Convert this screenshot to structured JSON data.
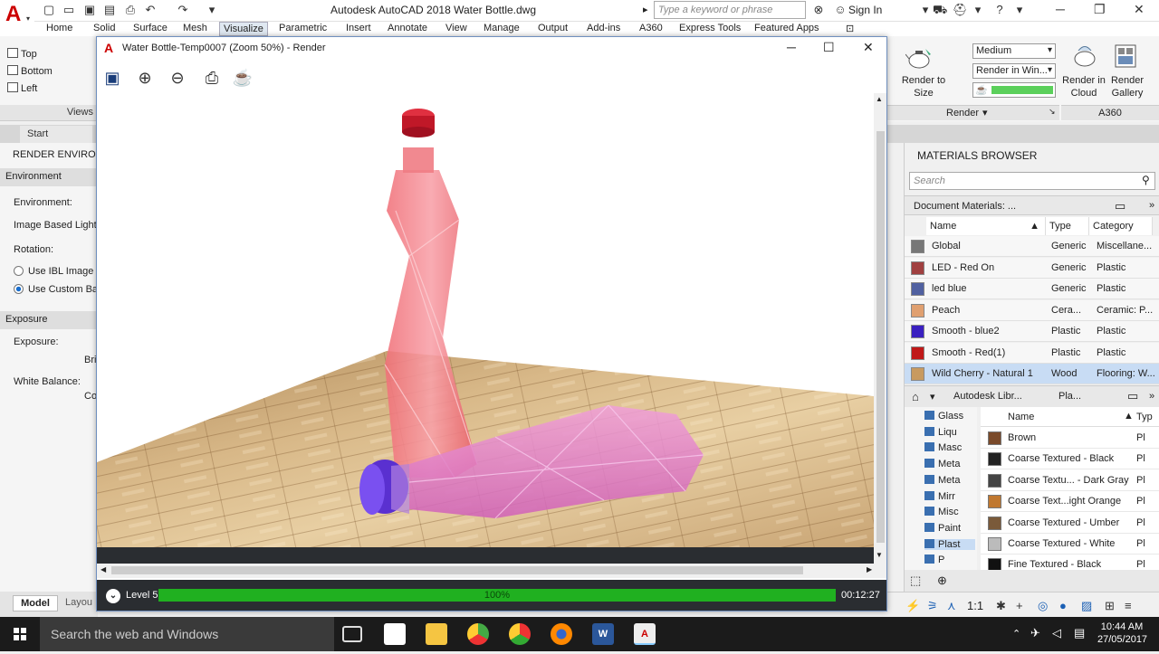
{
  "app": {
    "title": "Autodesk AutoCAD 2018   Water Bottle.dwg",
    "search_placeholder": "Type a keyword or phrase",
    "sign_in": "Sign In"
  },
  "ribbon_tabs": [
    "Home",
    "Solid",
    "Surface",
    "Mesh",
    "Visualize",
    "Parametric",
    "Insert",
    "Annotate",
    "View",
    "Manage",
    "Output",
    "Add-ins",
    "A360",
    "Express Tools",
    "Featured Apps"
  ],
  "views_panel": {
    "items": [
      "Top",
      "Bottom",
      "Left"
    ],
    "label": "Views"
  },
  "start_tab": "Start",
  "render_env": {
    "title": "RENDER ENVIRONI",
    "environment_section": "Environment",
    "environment_label": "Environment:",
    "ibl_label": "Image Based Light",
    "rotation_label": "Rotation:",
    "use_ibl": "Use IBL Image",
    "use_custom": "Use Custom Ba",
    "exposure_section": "Exposure",
    "exposure_label": "Exposure:",
    "bri": "Bri",
    "white_balance": "White Balance:",
    "co": "Co"
  },
  "layout_tabs": {
    "model": "Model",
    "layout": "Layou"
  },
  "render_window": {
    "title": "Water Bottle-Temp0007 (Zoom 50%) - Render",
    "level": "Level 5",
    "progress_label": "100%",
    "progress": 1.0,
    "time": "00:12:27"
  },
  "render_panel": {
    "quality": "Medium",
    "render_in": "Render in Win...",
    "render_to_size": "Render to Size",
    "render_in_cloud": "Render in Cloud",
    "render_gallery": "Render Gallery",
    "render_label": "Render",
    "a360_label": "A360"
  },
  "materials_browser": {
    "title": "MATERIALS BROWSER",
    "search_placeholder": "Search",
    "doc_materials": "Document Materials: ...",
    "columns": {
      "name": "Name",
      "type": "Type",
      "category": "Category"
    },
    "rows": [
      {
        "name": "Global",
        "type": "Generic",
        "category": "Miscellane...",
        "color": "#777777"
      },
      {
        "name": "LED - Red On",
        "type": "Generic",
        "category": "Plastic",
        "color": "#a04040"
      },
      {
        "name": "led blue",
        "type": "Generic",
        "category": "Plastic",
        "color": "#5060a0"
      },
      {
        "name": "Peach",
        "type": "Cera...",
        "category": "Ceramic: P...",
        "color": "#e0a070"
      },
      {
        "name": "Smooth - blue2",
        "type": "Plastic",
        "category": "Plastic",
        "color": "#3a20c0"
      },
      {
        "name": "Smooth - Red(1)",
        "type": "Plastic",
        "category": "Plastic",
        "color": "#c01818"
      },
      {
        "name": "Wild Cherry - Natural 1",
        "type": "Wood",
        "category": "Flooring: W...",
        "color": "#c89a60"
      }
    ],
    "library_path": [
      "Autodesk Libr...",
      "Pla..."
    ],
    "tree": [
      "Glass",
      "Liqu",
      "Masc",
      "Meta",
      "Meta",
      "Mirr",
      "Misc",
      "Paint",
      "Plast",
      "P"
    ],
    "library_columns": {
      "name": "Name",
      "type": "Typ"
    },
    "library_rows": [
      {
        "name": "Brown",
        "type": "Pl",
        "color": "#7a4a2a"
      },
      {
        "name": "Coarse Textured - Black",
        "type": "Pl",
        "color": "#222222"
      },
      {
        "name": "Coarse Textu... - Dark Gray",
        "type": "Pl",
        "color": "#444444"
      },
      {
        "name": "Coarse Text...ight Orange",
        "type": "Pl",
        "color": "#c07830"
      },
      {
        "name": "Coarse Textured - Umber",
        "type": "Pl",
        "color": "#7a5a3a"
      },
      {
        "name": "Coarse Textured - White",
        "type": "Pl",
        "color": "#bbbbbb"
      },
      {
        "name": "Fine Textured - Black",
        "type": "Pl",
        "color": "#111111"
      }
    ]
  },
  "status": {
    "scale": "1:1"
  },
  "taskbar": {
    "search": "Search the web and Windows",
    "time": "10:44 AM",
    "date": "27/05/2017"
  }
}
